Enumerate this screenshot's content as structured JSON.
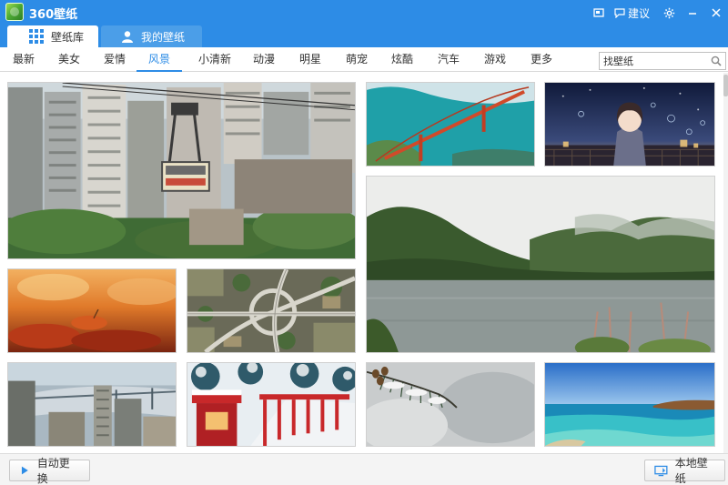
{
  "app": {
    "title": "360壁纸"
  },
  "titlebar": {
    "feedback_label": "建议"
  },
  "tabs": [
    {
      "label": "壁纸库",
      "active": true
    },
    {
      "label": "我的壁纸",
      "active": false
    }
  ],
  "categories": [
    "最新",
    "美女",
    "爱情",
    "风景",
    "小清新",
    "动漫",
    "明星",
    "萌宠",
    "炫酷",
    "汽车",
    "游戏",
    "更多"
  ],
  "active_category": "风景",
  "search": {
    "value": "找壁纸"
  },
  "wallpapers": [
    {
      "subject": "cable-car-city"
    },
    {
      "subject": "golden-gate-bridge"
    },
    {
      "subject": "anime-girl-night"
    },
    {
      "subject": "misty-lake-mountains"
    },
    {
      "subject": "autumn-leaves"
    },
    {
      "subject": "highway-interchange"
    },
    {
      "subject": "city-river-bridge"
    },
    {
      "subject": "red-lanterns-snow"
    },
    {
      "subject": "snowy-pine-branch"
    },
    {
      "subject": "tropical-coast"
    }
  ],
  "footer": {
    "auto_change_label": "自动更换",
    "local_label": "本地壁纸"
  },
  "colors": {
    "accent": "#2d8ce6",
    "titlebar": "#2d8ce6"
  }
}
